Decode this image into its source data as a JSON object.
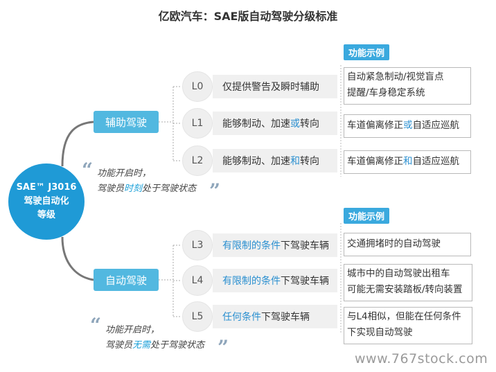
{
  "title": "亿欧汽车：SAE版自动驾驶分级标准",
  "hub": {
    "line1": "SAE™ J3016",
    "line2": "驾驶自动化",
    "line3": "等级"
  },
  "categories": [
    {
      "label": "辅助驾驶"
    },
    {
      "label": "自动驾驶"
    }
  ],
  "example_header": "功能示例",
  "levels": [
    {
      "id": "L0",
      "desc_pre": "仅提供警告及瞬时辅助",
      "desc_hl": "",
      "desc_post": "",
      "ex_line1_pre": "自动紧急制动/视觉盲点",
      "ex_line1_hl": "",
      "ex_line1_post": "",
      "ex_line2": "提醒/车身稳定系统"
    },
    {
      "id": "L1",
      "desc_pre": "能够制动、加速",
      "desc_hl": "或",
      "desc_post": "转向",
      "ex_line1_pre": "车道偏离修正",
      "ex_line1_hl": "或",
      "ex_line1_post": "自适应巡航",
      "ex_line2": ""
    },
    {
      "id": "L2",
      "desc_pre": "能够制动、加速",
      "desc_hl": "和",
      "desc_post": "转向",
      "ex_line1_pre": "车道偏离修正",
      "ex_line1_hl": "和",
      "ex_line1_post": "自适应巡航",
      "ex_line2": ""
    },
    {
      "id": "L3",
      "desc_pre": "",
      "desc_hl": "有限制的条件",
      "desc_post": "下驾驶车辆",
      "ex_line1_pre": "交通拥堵时的自动驾驶",
      "ex_line1_hl": "",
      "ex_line1_post": "",
      "ex_line2": ""
    },
    {
      "id": "L4",
      "desc_pre": "",
      "desc_hl": "有限制的条件",
      "desc_post": "下驾驶车辆",
      "ex_line1_pre": "城市中的自动驾驶出租车",
      "ex_line1_hl": "",
      "ex_line1_post": "",
      "ex_line2": "可能无需安装踏板/转向装置"
    },
    {
      "id": "L5",
      "desc_pre": "",
      "desc_hl": "任何条件",
      "desc_post": "下驾驶车辆",
      "ex_line1_pre": "与L4相似，但能在任何条件",
      "ex_line1_hl": "",
      "ex_line1_post": "",
      "ex_line2": "下实现自动驾驶"
    }
  ],
  "quote1": {
    "line1": "功能开启时，",
    "line2_pre": "驾驶员",
    "line2_hl": "时刻",
    "line2_post": "处于驾驶状态"
  },
  "quote2": {
    "line1": "功能开启时，",
    "line2_pre": "驾驶员",
    "line2_hl": "无需",
    "line2_post": "处于驾驶状态"
  },
  "quote_open": "“",
  "quote_close": "”",
  "watermark": "www.767stock.com",
  "colors": {
    "hub": "#1f9ad6",
    "category": "#52b8e0",
    "highlight": "#2a8fd0",
    "example_header": "#3aa9de"
  }
}
